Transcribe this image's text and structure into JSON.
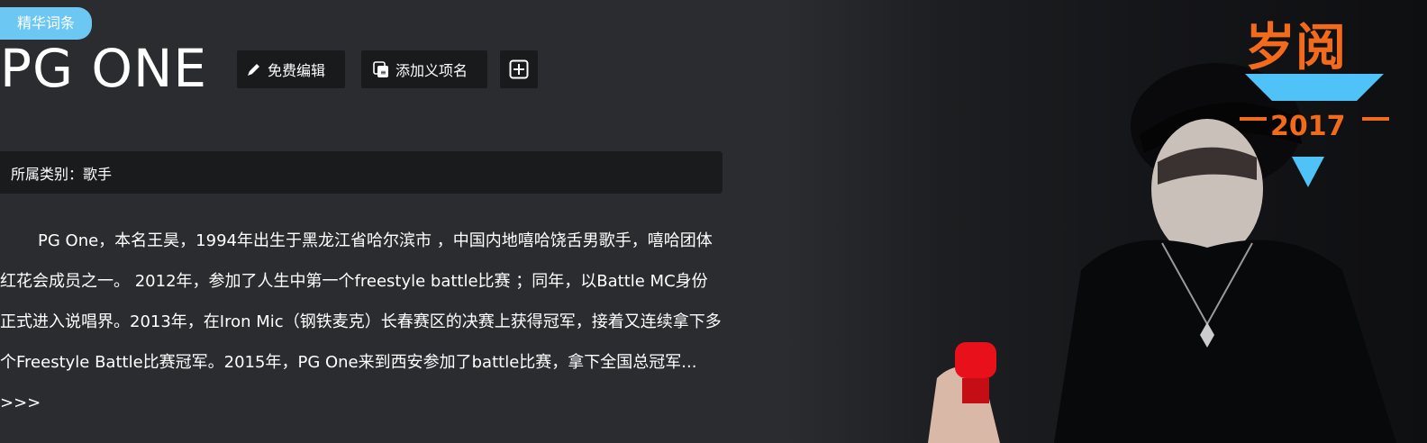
{
  "badge": {
    "label": "精华词条"
  },
  "title": "PG ONE",
  "toolbar": {
    "edit_label": "免费编辑",
    "add_label": "添加义项名"
  },
  "category": {
    "label": "所属类别：",
    "value": "歌手"
  },
  "summary": {
    "text": "PG One，本名王昊，1994年出生于黑龙江省哈尔滨市 ，中国内地嘻哈饶舌男歌手，嘻哈团体红花会成员之一。 2012年，参加了人生中第一个freestyle battle比赛 ；同年，以Battle MC身份正式进入说唱界。2013年，在Iron Mic（钢铁麦克）长春赛区的决赛上获得冠军，接着又连续拿下多个Freestyle Battle比赛冠军。2015年，PG One来到西安参加了battle比赛，拿下全国总冠军...",
    "more_label": ">>>"
  },
  "hero_logo": {
    "line1": "岁阅",
    "line2": "2017"
  },
  "colors": {
    "badge": "#6cc8f3",
    "logo_orange": "#f26a1b",
    "logo_blue": "#4fc3f7",
    "background": "#2a2c2f"
  }
}
